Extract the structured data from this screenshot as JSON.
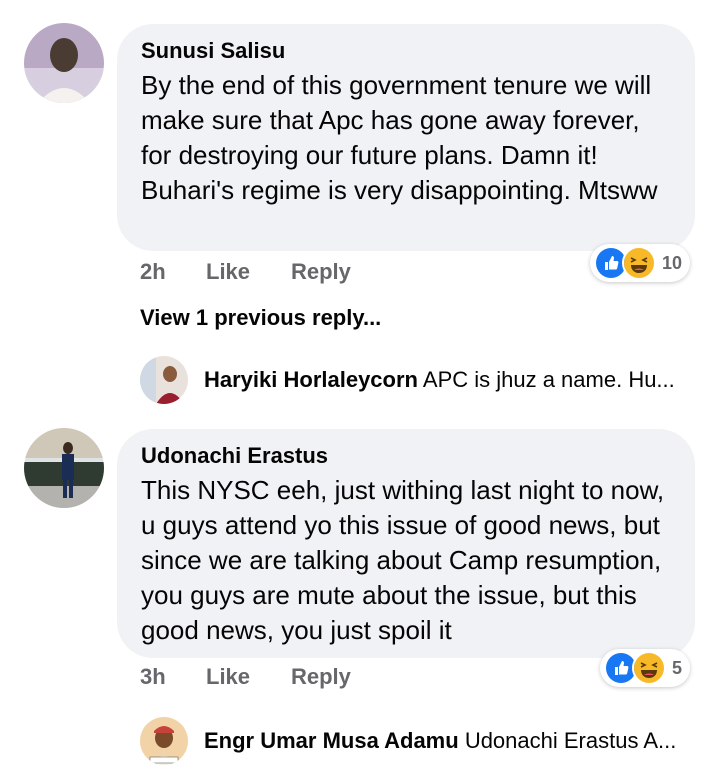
{
  "comments": [
    {
      "author": "Sunusi Salisu",
      "text": "By the end of this government tenure we will make sure that Apc has gone away forever, for destroying our future plans. Damn it! Buhari's regime is very disappointing. Mtsww",
      "time": "2h",
      "like_label": "Like",
      "reply_label": "Reply",
      "reaction_count": "10",
      "reaction_icons": [
        "like-icon",
        "haha-icon"
      ]
    },
    {
      "author": "Udonachi Erastus",
      "text": "This NYSC eeh, just withing last night to now, u guys attend yo this issue of good news, but since we are talking about Camp resumption,  you guys are mute about the issue, but this good news, you just spoil it",
      "time": "3h",
      "like_label": "Like",
      "reply_label": "Reply",
      "reaction_count": "5",
      "reaction_icons": [
        "like-icon",
        "haha-icon"
      ]
    }
  ],
  "view_previous_replies": "View 1 previous reply...",
  "replies": [
    {
      "author": "Haryiki Horlaleycorn",
      "text": "APC is jhuz a name. Hu..."
    },
    {
      "author": "Engr Umar Musa Adamu",
      "text": "Udonachi Erastus A..."
    }
  ],
  "colors": {
    "bubble": "#f0f2f5",
    "meta": "#65676b",
    "like_blue": "#1877f2",
    "haha_yellow": "#f7b928"
  }
}
